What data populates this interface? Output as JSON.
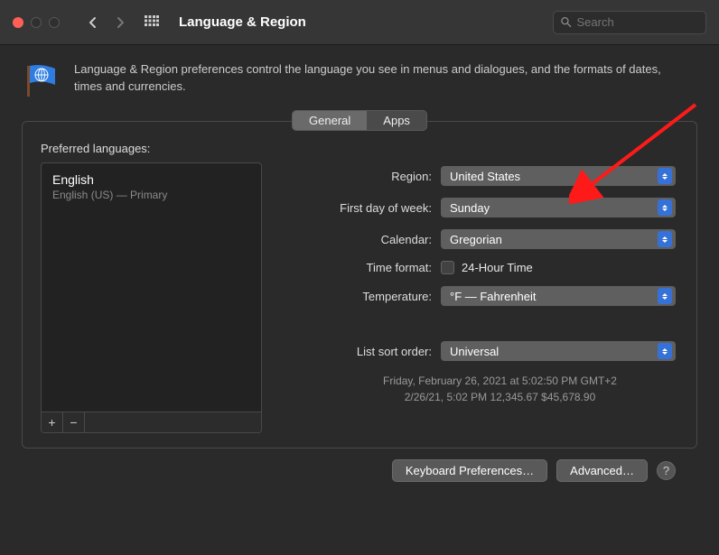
{
  "titlebar": {
    "title": "Language & Region",
    "search_placeholder": "Search"
  },
  "intro_text": "Language & Region preferences control the language you see in menus and dialogues, and the formats of dates, times and currencies.",
  "tabs": {
    "general": "General",
    "apps": "Apps"
  },
  "preferred_languages": {
    "label": "Preferred languages:",
    "add_label": "+",
    "remove_label": "−",
    "items": [
      {
        "name": "English",
        "subtitle": "English (US) — Primary"
      }
    ]
  },
  "settings": {
    "region": {
      "label": "Region:",
      "value": "United States"
    },
    "first_day": {
      "label": "First day of week:",
      "value": "Sunday"
    },
    "calendar": {
      "label": "Calendar:",
      "value": "Gregorian"
    },
    "time_format": {
      "label": "Time format:",
      "checkbox_label": "24-Hour Time"
    },
    "temperature": {
      "label": "Temperature:",
      "value": "°F — Fahrenheit"
    },
    "list_sort": {
      "label": "List sort order:",
      "value": "Universal"
    }
  },
  "examples": {
    "line1": "Friday, February 26, 2021 at 5:02:50 PM GMT+2",
    "line2": "2/26/21, 5:02 PM    12,345.67    $45,678.90"
  },
  "footer": {
    "keyboard": "Keyboard Preferences…",
    "advanced": "Advanced…",
    "help": "?"
  }
}
